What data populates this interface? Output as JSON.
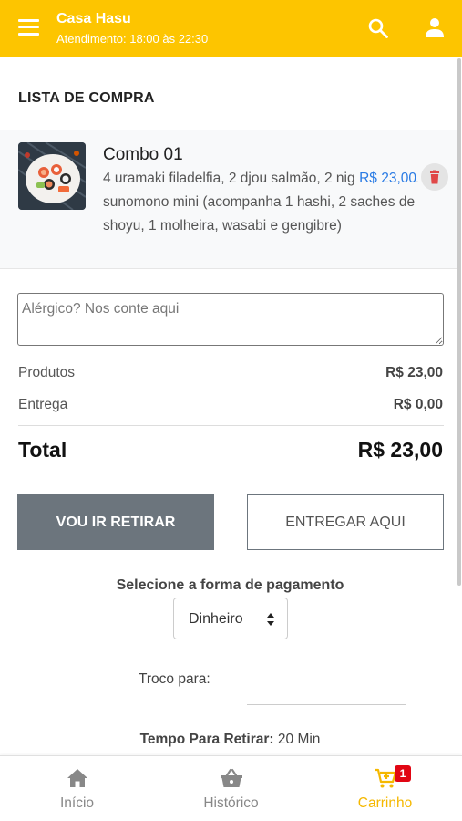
{
  "header": {
    "store_name": "Casa Hasu",
    "hours": "Atendimento: 18:00 às 22:30"
  },
  "section_title": "LISTA DE COMPRA",
  "cart_items": [
    {
      "name": "Combo 01",
      "description": "4 uramaki filadelfia, 2 djou salmão, 2 nigiri skin e 1 sunomono mini (acompanha 1 hashi, 2 saches de shoyu, 1 molheira, wasabi e gengibre)",
      "price": "R$ 23,00",
      "image": "sushi-plate"
    }
  ],
  "allergy_placeholder": "Alérgico? Nos conte aqui",
  "summary": {
    "products_label": "Produtos",
    "products_value": "R$ 23,00",
    "delivery_label": "Entrega",
    "delivery_value": "R$ 0,00",
    "total_label": "Total",
    "total_value": "R$ 23,00"
  },
  "buttons": {
    "pickup": "VOU IR RETIRAR",
    "deliver": "ENTREGAR AQUI"
  },
  "payment": {
    "title": "Selecione a forma de pagamento",
    "selected": "Dinheiro",
    "change_label": "Troco para:",
    "change_value": ""
  },
  "pickup_time": {
    "label": "Tempo Para Retirar:",
    "value": "20 Min"
  },
  "bottom_nav": {
    "items": [
      {
        "label": "Início",
        "icon": "home-icon",
        "active": false
      },
      {
        "label": "Histórico",
        "icon": "basket-icon",
        "active": false
      },
      {
        "label": "Carrinho",
        "icon": "cart-icon",
        "active": true,
        "badge": "1"
      }
    ]
  },
  "colors": {
    "brand": "#FDC500",
    "active_nav": "#F5B800",
    "price": "#2a7be4",
    "primary_button": "#6c757d",
    "badge": "#e10613",
    "delete": "#e04848"
  }
}
